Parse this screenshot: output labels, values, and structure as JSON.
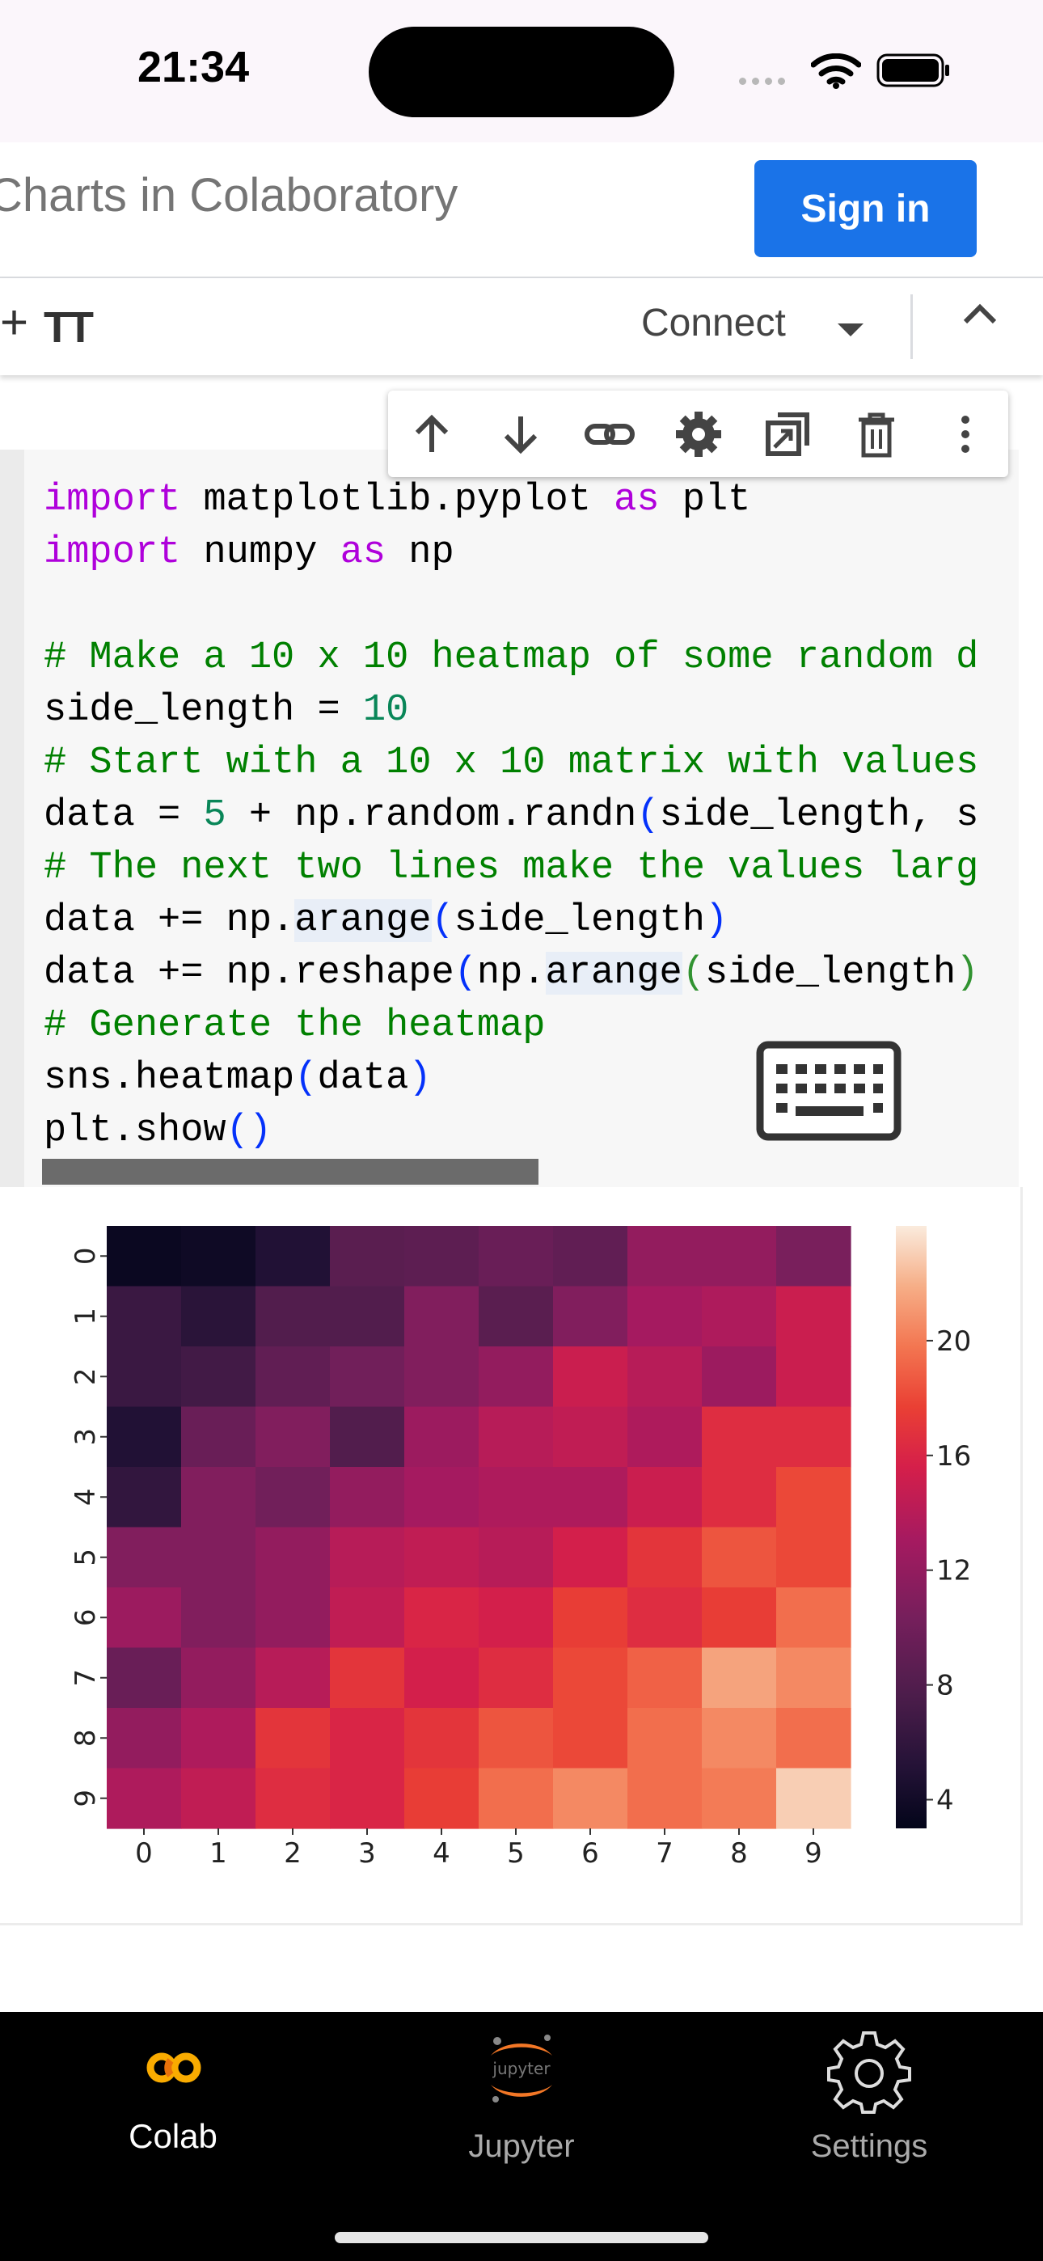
{
  "status_bar": {
    "time": "21:34"
  },
  "header": {
    "title": "Charts in Colaboratory",
    "sign_in_label": "Sign in"
  },
  "toolbar": {
    "add_label": "+",
    "text_label": "TT",
    "connect_label": "Connect"
  },
  "cell_toolbar": {
    "icons": [
      "move-up-icon",
      "move-down-icon",
      "link-icon",
      "gear-icon",
      "mirror-cell-icon",
      "delete-icon",
      "more-vert-icon"
    ]
  },
  "code": {
    "lines": [
      "import matplotlib.pyplot as plt",
      "import numpy as np",
      "",
      "# Make a 10 x 10 heatmap of some random d",
      "side_length = 10",
      "# Start with a 10 x 10 matrix with values",
      "data = 5 + np.random.randn(side_length, s",
      "# The next two lines make the values larg",
      "data += np.arange(side_length)",
      "data += np.reshape(np.arange(side_length)",
      "# Generate the heatmap",
      "sns.heatmap(data)",
      "plt.show()"
    ]
  },
  "chart_data": {
    "type": "heatmap",
    "x_categories": [
      "0",
      "1",
      "2",
      "3",
      "4",
      "5",
      "6",
      "7",
      "8",
      "9"
    ],
    "y_categories": [
      "0",
      "1",
      "2",
      "3",
      "4",
      "5",
      "6",
      "7",
      "8",
      "9"
    ],
    "values": [
      [
        3.5,
        3.8,
        5.0,
        8.5,
        8.7,
        9.5,
        9.0,
        12.0,
        12.0,
        10.5
      ],
      [
        6.5,
        5.5,
        8.0,
        8.0,
        11.0,
        8.5,
        11.0,
        13.0,
        13.5,
        15.0
      ],
      [
        6.5,
        7.0,
        9.0,
        10.0,
        11.0,
        12.0,
        15.0,
        14.0,
        12.5,
        15.0
      ],
      [
        5.0,
        9.5,
        11.0,
        8.0,
        12.5,
        14.0,
        14.5,
        13.5,
        16.5,
        16.5
      ],
      [
        6.0,
        11.0,
        10.0,
        12.0,
        13.0,
        13.5,
        13.5,
        15.0,
        16.5,
        18.0
      ],
      [
        11.0,
        11.0,
        12.0,
        14.0,
        14.5,
        14.0,
        15.5,
        17.0,
        18.5,
        18.0
      ],
      [
        12.5,
        11.0,
        12.0,
        14.5,
        16.0,
        15.5,
        17.5,
        16.5,
        17.5,
        19.5
      ],
      [
        9.5,
        12.0,
        14.0,
        17.0,
        15.5,
        16.5,
        18.0,
        19.0,
        21.5,
        20.5
      ],
      [
        12.0,
        13.5,
        17.0,
        16.0,
        17.0,
        18.5,
        18.0,
        19.5,
        20.5,
        19.5
      ],
      [
        13.5,
        14.5,
        16.5,
        16.0,
        17.5,
        19.5,
        20.5,
        19.5,
        20.0,
        23.0
      ]
    ],
    "colorbar_ticks": [
      "20",
      "16",
      "12",
      "8",
      "4"
    ],
    "colorbar_range": [
      3,
      24
    ],
    "colormap": "rocket"
  },
  "bottom_nav": {
    "items": [
      {
        "label": "Colab",
        "icon": "colab-logo-icon",
        "active": true
      },
      {
        "label": "Jupyter",
        "icon": "jupyter-logo-icon",
        "logo_text": "jupyter",
        "active": false
      },
      {
        "label": "Settings",
        "icon": "gear-icon",
        "active": false
      }
    ]
  },
  "colors": {
    "accent": "#1a73e8",
    "colab_orange": "#f9ab00"
  }
}
